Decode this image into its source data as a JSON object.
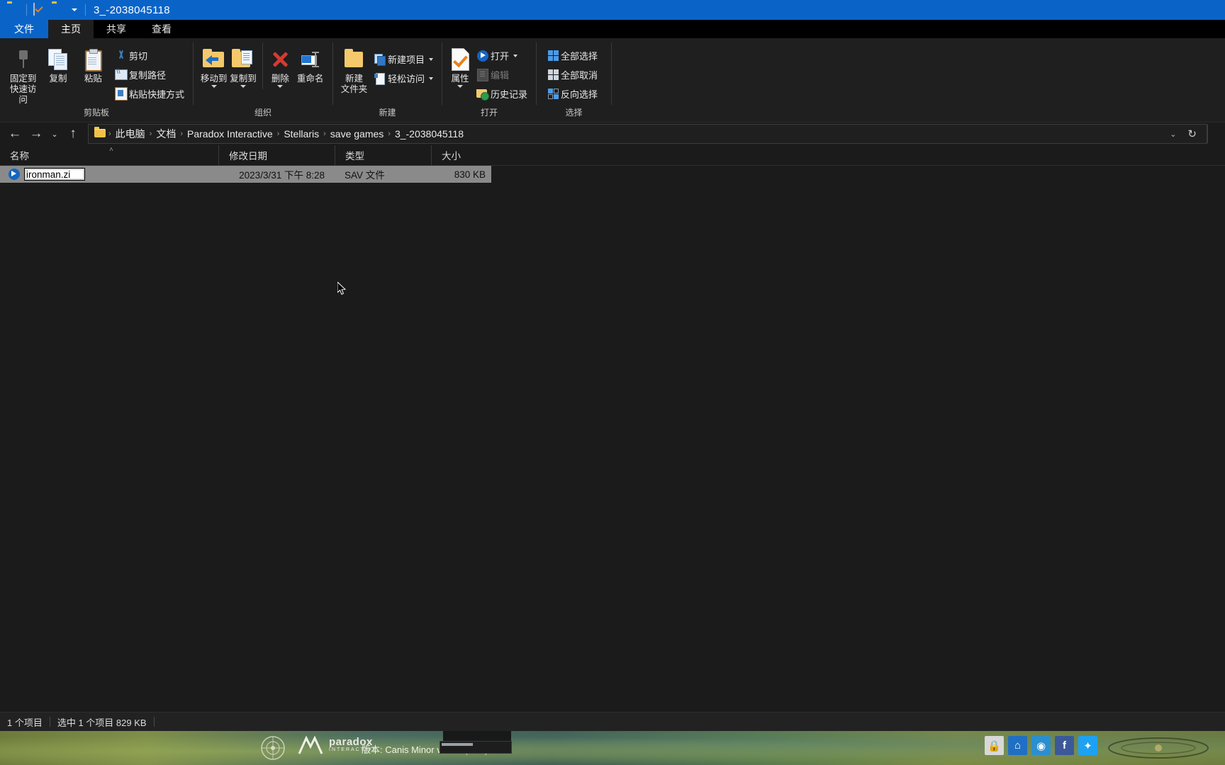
{
  "window": {
    "title": "3_-2038045118",
    "qat": [
      {
        "name": "folder-icon"
      },
      {
        "name": "properties-icon"
      },
      {
        "name": "new-folder-icon"
      }
    ]
  },
  "tabs": [
    {
      "id": "file",
      "label": "文件"
    },
    {
      "id": "home",
      "label": "主页"
    },
    {
      "id": "share",
      "label": "共享"
    },
    {
      "id": "view",
      "label": "查看"
    }
  ],
  "ribbon": {
    "groups": [
      {
        "id": "clipboard",
        "label": "剪贴板",
        "big": [
          {
            "id": "pin-to-quick-access",
            "label_line1": "固定到",
            "label_line2": "快速访问",
            "icon": "pin-icon"
          },
          {
            "id": "copy",
            "label_line1": "复制",
            "label_line2": "",
            "icon": "copy-icon"
          },
          {
            "id": "paste",
            "label_line1": "粘贴",
            "label_line2": "",
            "icon": "paste-icon"
          }
        ],
        "small": [
          {
            "id": "cut",
            "label": "剪切",
            "icon": "scissors-icon"
          },
          {
            "id": "copy-path",
            "label": "复制路径",
            "icon": "copy-path-icon"
          },
          {
            "id": "paste-shortcut",
            "label": "粘贴快捷方式",
            "icon": "paste-shortcut-icon"
          }
        ]
      },
      {
        "id": "organize",
        "label": "组织",
        "big": [
          {
            "id": "move-to",
            "label_line1": "移动到",
            "label_line2": "",
            "icon": "move-to-icon",
            "has_dropdown": true
          },
          {
            "id": "copy-to",
            "label_line1": "复制到",
            "label_line2": "",
            "icon": "copy-to-icon",
            "has_dropdown": true
          },
          {
            "id": "delete",
            "label_line1": "删除",
            "label_line2": "",
            "icon": "delete-icon",
            "has_dropdown": true
          },
          {
            "id": "rename",
            "label_line1": "重命名",
            "label_line2": "",
            "icon": "rename-icon"
          }
        ],
        "small": []
      },
      {
        "id": "new",
        "label": "新建",
        "big": [
          {
            "id": "new-folder",
            "label_line1": "新建",
            "label_line2": "文件夹",
            "icon": "new-folder-icon"
          }
        ],
        "small": [
          {
            "id": "new-item",
            "label": "新建项目",
            "icon": "new-item-icon",
            "has_dropdown": true
          },
          {
            "id": "easy-access",
            "label": "轻松访问",
            "icon": "easy-access-icon",
            "has_dropdown": true
          }
        ]
      },
      {
        "id": "open",
        "label": "打开",
        "big": [
          {
            "id": "properties",
            "label_line1": "属性",
            "label_line2": "",
            "icon": "properties-icon",
            "has_dropdown": true
          }
        ],
        "small": [
          {
            "id": "open",
            "label": "打开",
            "icon": "open-icon",
            "has_dropdown": true
          },
          {
            "id": "edit",
            "label": "编辑",
            "icon": "edit-icon",
            "disabled": true
          },
          {
            "id": "history",
            "label": "历史记录",
            "icon": "history-icon"
          }
        ]
      },
      {
        "id": "select",
        "label": "选择",
        "big": [],
        "small": [
          {
            "id": "select-all",
            "label": "全部选择",
            "icon": "select-all-icon"
          },
          {
            "id": "select-none",
            "label": "全部取消",
            "icon": "select-none-icon"
          },
          {
            "id": "invert-selection",
            "label": "反向选择",
            "icon": "invert-selection-icon"
          }
        ]
      }
    ]
  },
  "nav": {
    "back": "←",
    "forward": "→",
    "recent": "⌄",
    "up": "↑"
  },
  "address": {
    "crumbs": [
      "此电脑",
      "文档",
      "Paradox Interactive",
      "Stellaris",
      "save games",
      "3_-2038045118"
    ],
    "separator": "›",
    "dropdown_icon": "chevron-down-icon",
    "refresh_icon": "refresh-icon"
  },
  "columns": [
    {
      "id": "name",
      "label": "名称",
      "sorted": "asc",
      "sort_glyph": "˄"
    },
    {
      "id": "date",
      "label": "修改日期"
    },
    {
      "id": "type",
      "label": "类型"
    },
    {
      "id": "size",
      "label": "大小"
    }
  ],
  "files": [
    {
      "icon": "sav-file-icon",
      "name": "ironman.zi",
      "renaming": true,
      "date": "2023/3/31 下午 8:28",
      "type": "SAV 文件",
      "size": "830 KB"
    }
  ],
  "status": {
    "item_count": "1 个项目",
    "selection": "选中 1 个项目  829 KB"
  },
  "gamebar": {
    "publisher": "paradox",
    "publisher_sub": "INTERACTIVE",
    "version": "版本: Canis Minor v3.7.4 (fc72)",
    "icons": [
      {
        "id": "lock",
        "glyph": "🔒",
        "name": "lock-icon"
      },
      {
        "id": "home",
        "glyph": "⌂",
        "name": "home-icon"
      },
      {
        "id": "globe",
        "glyph": "◉",
        "name": "globe-icon"
      },
      {
        "id": "facebook",
        "glyph": "f",
        "name": "facebook-icon"
      },
      {
        "id": "twitter",
        "glyph": "✦",
        "name": "twitter-icon"
      }
    ]
  },
  "colors": {
    "titlebar": "#0a64c8",
    "selection_row": "#8a8a8a",
    "accent_folder": "#f5c96b"
  }
}
